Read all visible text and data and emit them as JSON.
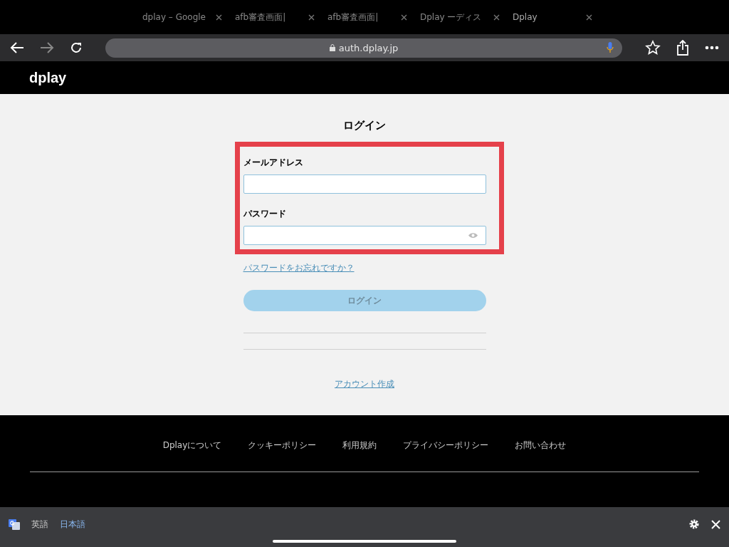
{
  "browser": {
    "tabs": [
      {
        "title": "dplay – Google",
        "selected": false
      },
      {
        "title": "afb審査画面|",
        "selected": false
      },
      {
        "title": "afb審査画面|",
        "selected": false
      },
      {
        "title": "Dplay ーディス",
        "selected": false
      },
      {
        "title": "Dplay",
        "selected": true
      }
    ],
    "address": "auth.dplay.jp"
  },
  "site": {
    "logo": "dplay"
  },
  "login": {
    "title": "ログイン",
    "fields": [
      {
        "label": "メールアドレス",
        "kind": "text"
      },
      {
        "label": "パスワード",
        "kind": "password"
      }
    ],
    "forgot_link": "パスワードをお忘れですか？",
    "submit": "ログイン",
    "disabled": true,
    "create_account": "アカウント作成"
  },
  "footer": {
    "links": [
      "Dplayについて",
      "クッキーポリシー",
      "利用規約",
      "プライバシーポリシー",
      "お問い合わせ"
    ]
  },
  "translate_bar": {
    "languages": [
      {
        "label": "英語",
        "selected": false
      },
      {
        "label": "日本語",
        "selected": true
      }
    ]
  }
}
